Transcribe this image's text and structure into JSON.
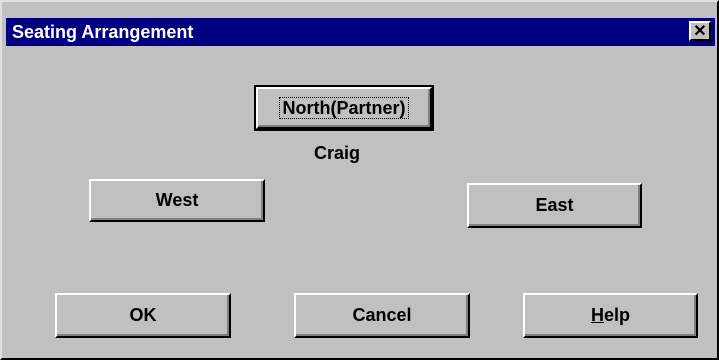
{
  "window": {
    "title": "Seating Arrangement",
    "close_symbol": "✕"
  },
  "seats": {
    "north_label": "North(Partner)",
    "north_player": "Craig",
    "west_label": "West",
    "east_label": "East"
  },
  "buttons": {
    "ok_label": "OK",
    "cancel_label": "Cancel",
    "help_label_accel": "H",
    "help_label_rest": "elp"
  },
  "colors": {
    "face": "#c0c0c0",
    "titlebar": "#000080",
    "title_text": "#ffffff"
  },
  "icons": {
    "close": "close-icon"
  }
}
